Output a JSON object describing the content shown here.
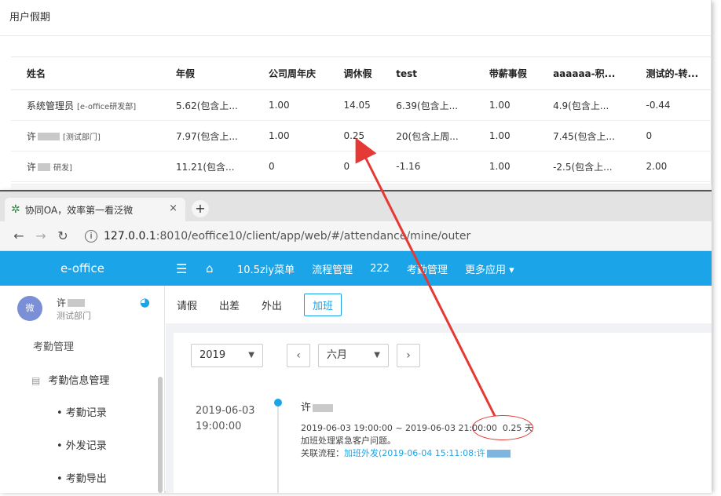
{
  "top_panel": {
    "title": "用户假期",
    "columns": [
      "姓名",
      "年假",
      "公司周年庆",
      "调休假",
      "test",
      "带薪事假",
      "aaaaaa-积...",
      "测试的-转..."
    ],
    "rows": [
      {
        "name": "系统管理员",
        "dept": "[e-office研发部]",
        "cells": [
          "5.62(包含上...",
          "1.00",
          "14.05",
          "6.39(包含上...",
          "1.00",
          "4.9(包含上...",
          "-0.44"
        ]
      },
      {
        "name": "许",
        "dept": "[测试部门]",
        "cells": [
          "7.97(包含上...",
          "1.00",
          "0.25",
          "20(包含上周...",
          "1.00",
          "7.45(包含上...",
          "0"
        ]
      },
      {
        "name": "许",
        "dept": "研发]",
        "cells": [
          "11.21(包含...",
          "0",
          "0",
          "-1.16",
          "1.00",
          "-2.5(包含上...",
          "2.00"
        ]
      }
    ]
  },
  "browser": {
    "tab_title": "协同OA，效率第一看泛微",
    "tab_close": "×",
    "new_tab": "+",
    "url_host": "127.0.0.1",
    "url_path": ":8010/eoffice10/client/app/web/#/attendance/mine/outer"
  },
  "appbar": {
    "brand": "e-office",
    "menu": [
      "10.5ziy菜单",
      "流程管理",
      "222",
      "考勤管理",
      "更多应用 ▾"
    ]
  },
  "sidebar": {
    "user_name": "许",
    "user_dept": "测试部门",
    "avatar_text": "微",
    "section": "考勤管理",
    "group": "考勤信息管理",
    "items": [
      "• 考勤记录",
      "• 外发记录",
      "• 考勤导出"
    ]
  },
  "subtabs": [
    "请假",
    "出差",
    "外出",
    "加班"
  ],
  "filters": {
    "year": "2019",
    "month": "六月"
  },
  "record": {
    "date": "2019-06-03",
    "time": "19:00:00",
    "who": "许",
    "range": "2019-06-03 19:00:00 ~ 2019-06-03 21:00:00",
    "duration": "0.25 天",
    "reason": "加班处理紧急客户问题。",
    "related_label": "关联流程：",
    "related_link": "加班外发(2019-06-04 15:11:08:许"
  },
  "colors": {
    "accent": "#1ba5e8",
    "annotation": "#e53935"
  }
}
